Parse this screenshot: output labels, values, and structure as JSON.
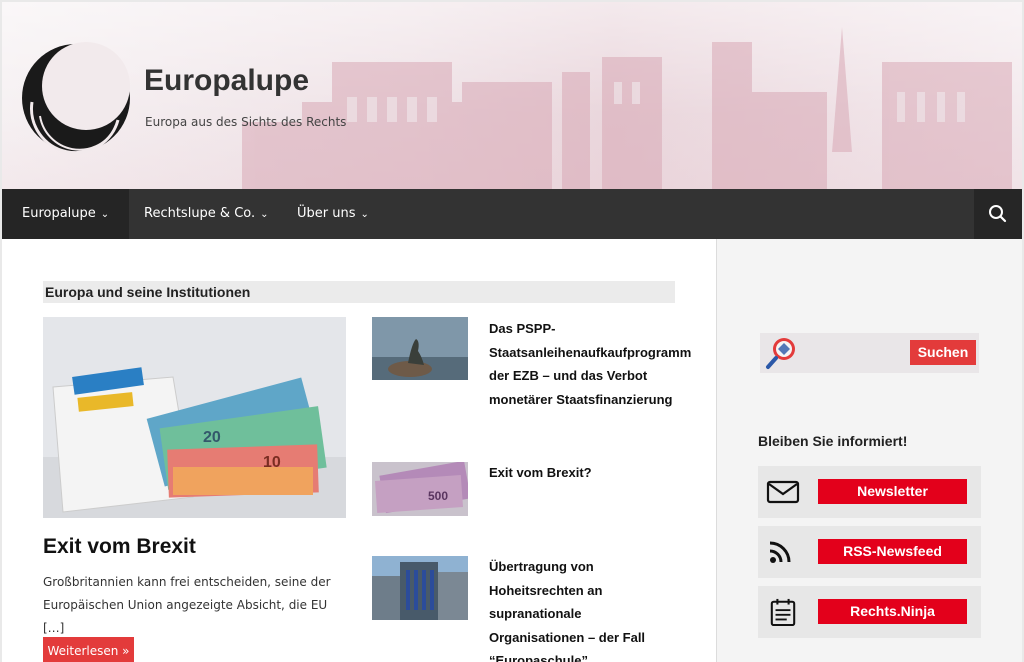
{
  "header": {
    "title": "Europalupe",
    "tagline": "Europa aus des Sichts des Rechts"
  },
  "nav": {
    "items": [
      {
        "label": "Europalupe"
      },
      {
        "label": "Rechtslupe & Co."
      },
      {
        "label": "Über uns"
      }
    ],
    "chevron": "⌄"
  },
  "main": {
    "section_title": "Europa und seine Institutionen",
    "feature": {
      "title": "Exit vom Brexit",
      "excerpt": "Großbritannien kann frei entscheiden, seine der Euro­päischen Union angezeigte Absicht, die EU […]",
      "read_more": "Weiterlesen »"
    },
    "posts": [
      {
        "title": "Das PSPP-Staatsanleihenaufkaufprogramm der EZB – und das Verbot monetärer Staatsfinanzierung"
      },
      {
        "title": "Exit vom Brexit?"
      },
      {
        "title": "Übertragung von Hoheitsrechten an supranationale Organisationen – der Fall “Europaschule”"
      }
    ]
  },
  "sidebar": {
    "search_label": "Suchen",
    "stay_title": "Bleiben Sie informiert!",
    "subscriptions": [
      {
        "label": "Newsletter",
        "icon": "mail-icon"
      },
      {
        "label": "RSS-Newsfeed",
        "icon": "rss-icon"
      },
      {
        "label": "Rechts.Ninja",
        "icon": "calendar-icon"
      }
    ]
  },
  "colors": {
    "accent": "#e33b3b",
    "nav_bg": "#333333",
    "subscribe_red": "#e3001b"
  }
}
